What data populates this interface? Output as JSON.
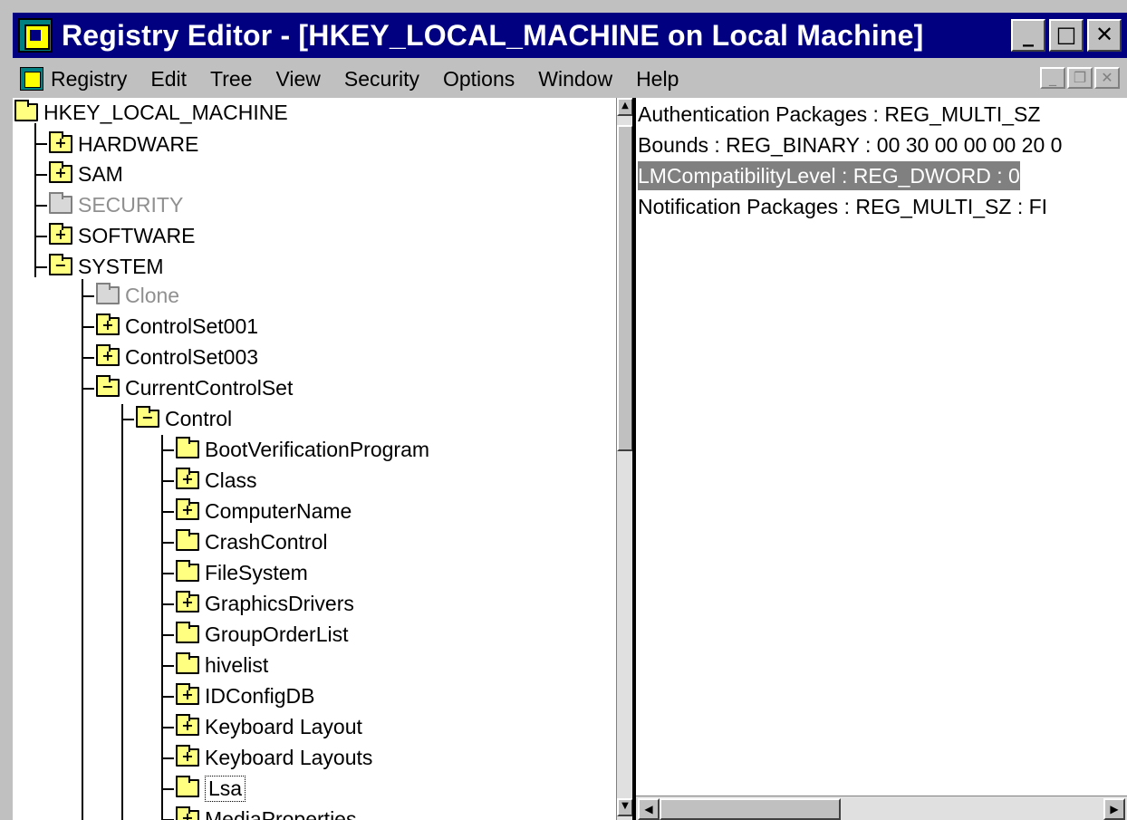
{
  "window": {
    "title": "Registry Editor - [HKEY_LOCAL_MACHINE on Local Machine]",
    "controls": {
      "minimize": "_",
      "maximize": "□",
      "close": "✕"
    },
    "accent": "#000080"
  },
  "menu": {
    "items": [
      "Registry",
      "Edit",
      "Tree",
      "View",
      "Security",
      "Options",
      "Window",
      "Help"
    ],
    "mdi_controls": {
      "minimize": "_",
      "restore": "❐",
      "close": "✕"
    }
  },
  "tree": {
    "root": "HKEY_LOCAL_MACHINE",
    "nodes": [
      {
        "label": "HARDWARE",
        "expander": "+"
      },
      {
        "label": "SAM",
        "expander": "+"
      },
      {
        "label": "SECURITY",
        "expander": ""
      },
      {
        "label": "SOFTWARE",
        "expander": "+"
      },
      {
        "label": "SYSTEM",
        "expander": "−"
      },
      {
        "label": "Clone",
        "expander": ""
      },
      {
        "label": "ControlSet001",
        "expander": "+"
      },
      {
        "label": "ControlSet003",
        "expander": "+"
      },
      {
        "label": "CurrentControlSet",
        "expander": "−"
      },
      {
        "label": "Control",
        "expander": "−"
      },
      {
        "label": "BootVerificationProgram",
        "expander": ""
      },
      {
        "label": "Class",
        "expander": "+"
      },
      {
        "label": "ComputerName",
        "expander": "+"
      },
      {
        "label": "CrashControl",
        "expander": ""
      },
      {
        "label": "FileSystem",
        "expander": ""
      },
      {
        "label": "GraphicsDrivers",
        "expander": "+"
      },
      {
        "label": "GroupOrderList",
        "expander": ""
      },
      {
        "label": "hivelist",
        "expander": ""
      },
      {
        "label": "IDConfigDB",
        "expander": "+"
      },
      {
        "label": "Keyboard Layout",
        "expander": "+"
      },
      {
        "label": "Keyboard Layouts",
        "expander": "+"
      },
      {
        "label": "Lsa",
        "expander": ""
      },
      {
        "label": "MediaProperties",
        "expander": "+"
      }
    ]
  },
  "values": [
    {
      "text": "Authentication Packages : REG_MULTI_SZ"
    },
    {
      "text": "Bounds : REG_BINARY : 00 30 00 00 00 20 0"
    },
    {
      "text": "LMCompatibilityLevel : REG_DWORD : 0"
    },
    {
      "text": "Notification Packages : REG_MULTI_SZ : FI"
    }
  ],
  "scrollbar": {
    "up": "▲",
    "down": "▼",
    "left": "◀",
    "right": "▶"
  }
}
